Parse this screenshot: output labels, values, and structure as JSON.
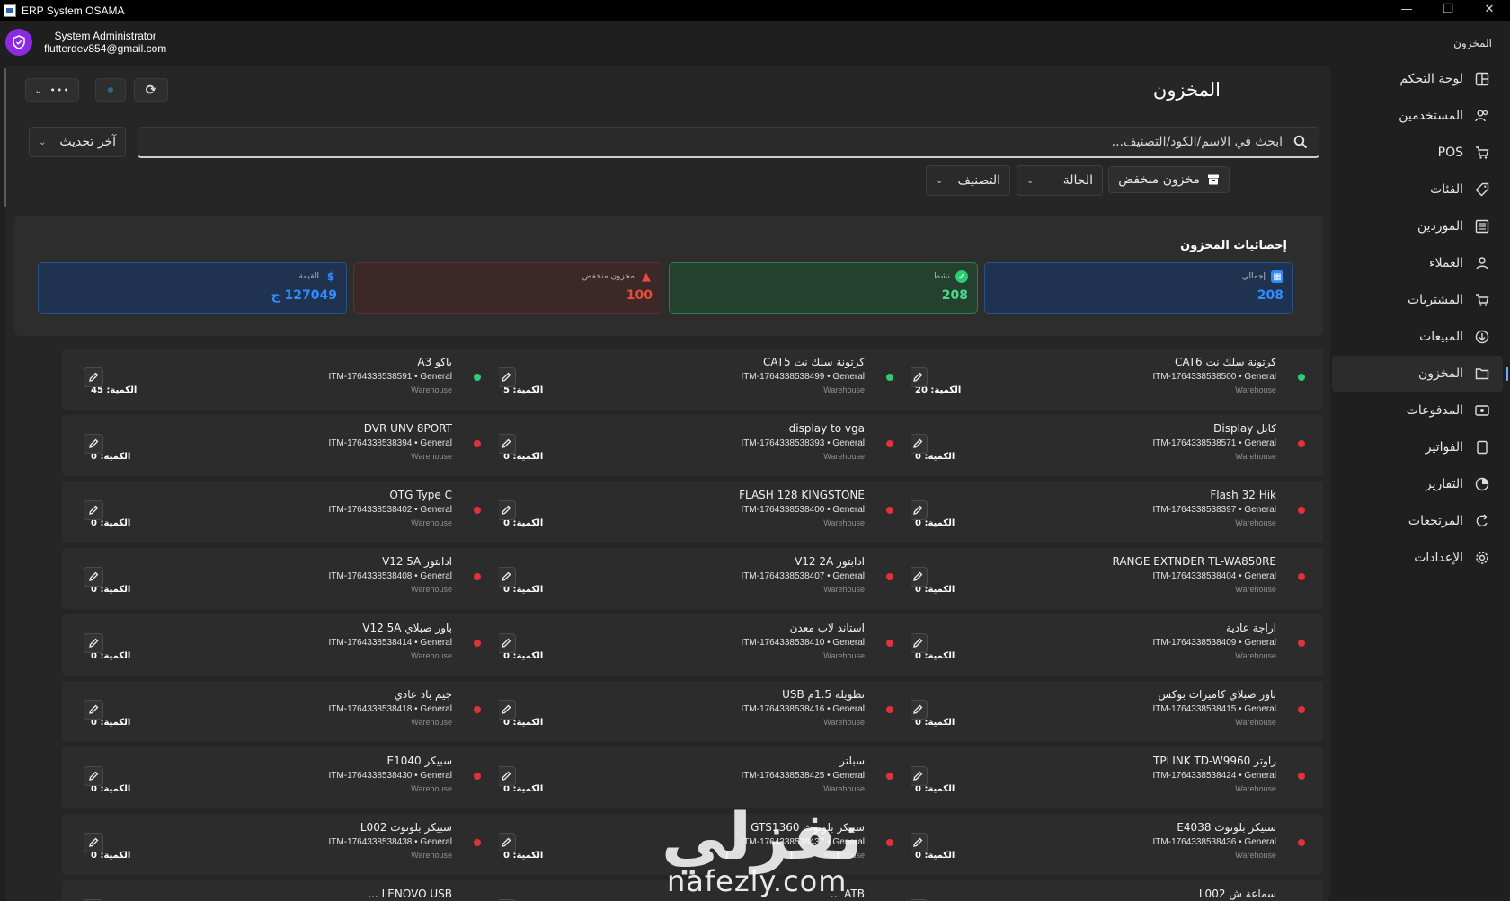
{
  "window": {
    "title": "ERP System OSAMA",
    "min": "—",
    "max": "❐",
    "close": "✕"
  },
  "user": {
    "name": "System Administrator",
    "email": "flutterdev854@gmail.com"
  },
  "breadcrumb": "المخزون",
  "sidebar": {
    "items": [
      {
        "label": "لوحة التحكم",
        "icon": "dashboard-icon"
      },
      {
        "label": "المستخدمين",
        "icon": "users-icon"
      },
      {
        "label": "POS",
        "icon": "cart-icon"
      },
      {
        "label": "الفئات",
        "icon": "tag-icon"
      },
      {
        "label": "الموردين",
        "icon": "suppliers-icon"
      },
      {
        "label": "العملاء",
        "icon": "person-icon"
      },
      {
        "label": "المشتريات",
        "icon": "cart-icon"
      },
      {
        "label": "المبيعات",
        "icon": "sales-icon"
      },
      {
        "label": "المخزون",
        "icon": "folder-icon",
        "active": true
      },
      {
        "label": "المدفوعات",
        "icon": "payments-icon"
      },
      {
        "label": "الفواتير",
        "icon": "invoice-icon"
      },
      {
        "label": "التقارير",
        "icon": "reports-icon"
      },
      {
        "label": "المرتجعات",
        "icon": "returns-icon"
      },
      {
        "label": "الإعدادات",
        "icon": "settings-icon"
      }
    ]
  },
  "page": {
    "title": "المخزون"
  },
  "toolbar": {
    "more": "•••",
    "more_chev": "⌄",
    "refresh": "⟳"
  },
  "search": {
    "placeholder": "ابحث في الاسم/الكود/التصنيف..."
  },
  "sort": {
    "label": "آخر تحديث"
  },
  "filters": {
    "low_stock": "مخزون منخفض",
    "status": "الحالة",
    "category": "التصنيف"
  },
  "stats": {
    "title": "إحصائيات المخزون",
    "total": {
      "label": "إجمالي",
      "value": "208",
      "color": "#2f8cff"
    },
    "active": {
      "label": "نشط",
      "value": "208",
      "color": "#2ecc71"
    },
    "low": {
      "label": "مخزون منخفض",
      "value": "100",
      "color": "#e74c3c"
    },
    "worth": {
      "label": "القيمة",
      "value": "127049 ج",
      "color": "#2f8cff"
    }
  },
  "qty_label": "الكمية:",
  "items": [
    {
      "name": "كرتونة سلك نت CAT6",
      "code": "ITM-1764338538500 • General",
      "wh": "Warehouse",
      "qty": "20",
      "status": "ok"
    },
    {
      "name": "كرتونة سلك نت CAT5",
      "code": "ITM-1764338538499 • General",
      "wh": "Warehouse",
      "qty": "5",
      "status": "ok"
    },
    {
      "name": "باكو A3",
      "code": "ITM-1764338538591 • General",
      "wh": "Warehouse",
      "qty": "45",
      "status": "ok"
    },
    {
      "name": "كابل Display",
      "code": "ITM-1764338538571 • General",
      "wh": "Warehouse",
      "qty": "0",
      "status": "low"
    },
    {
      "name": "display to vga",
      "code": "ITM-1764338538393 • General",
      "wh": "Warehouse",
      "qty": "0",
      "status": "low"
    },
    {
      "name": "DVR UNV 8PORT",
      "code": "ITM-1764338538394 • General",
      "wh": "Warehouse",
      "qty": "0",
      "status": "low"
    },
    {
      "name": "Flash 32 Hik",
      "code": "ITM-1764338538397 • General",
      "wh": "Warehouse",
      "qty": "0",
      "status": "low"
    },
    {
      "name": "FLASH 128 KINGSTONE",
      "code": "ITM-1764338538400 • General",
      "wh": "Warehouse",
      "qty": "0",
      "status": "low"
    },
    {
      "name": "OTG Type C",
      "code": "ITM-1764338538402 • General",
      "wh": "Warehouse",
      "qty": "0",
      "status": "low"
    },
    {
      "name": "RANGE EXTNDER TL-WA850RE",
      "code": "ITM-1764338538404 • General",
      "wh": "Warehouse",
      "qty": "0",
      "status": "low"
    },
    {
      "name": "ادابتور V12 2A",
      "code": "ITM-1764338538407 • General",
      "wh": "Warehouse",
      "qty": "0",
      "status": "low"
    },
    {
      "name": "ادابتور V12 5A",
      "code": "ITM-1764338538408 • General",
      "wh": "Warehouse",
      "qty": "0",
      "status": "low"
    },
    {
      "name": "اراجة عادية",
      "code": "ITM-1764338538409 • General",
      "wh": "Warehouse",
      "qty": "0",
      "status": "low"
    },
    {
      "name": "استاند لاب معدن",
      "code": "ITM-1764338538410 • General",
      "wh": "Warehouse",
      "qty": "0",
      "status": "low"
    },
    {
      "name": "باور صبلاي V12 5A",
      "code": "ITM-1764338538414 • General",
      "wh": "Warehouse",
      "qty": "0",
      "status": "low"
    },
    {
      "name": "باور صبلاي كاميرات بوكس",
      "code": "ITM-1764338538415 • General",
      "wh": "Warehouse",
      "qty": "0",
      "status": "low"
    },
    {
      "name": "تطويلة 1.5م USB",
      "code": "ITM-1764338538416 • General",
      "wh": "Warehouse",
      "qty": "0",
      "status": "low"
    },
    {
      "name": "جيم باد عادي",
      "code": "ITM-1764338538418 • General",
      "wh": "Warehouse",
      "qty": "0",
      "status": "low"
    },
    {
      "name": "راوتر TPLINK TD-W9960",
      "code": "ITM-1764338538424 • General",
      "wh": "Warehouse",
      "qty": "0",
      "status": "low"
    },
    {
      "name": "سبلتر",
      "code": "ITM-1764338538425 • General",
      "wh": "Warehouse",
      "qty": "0",
      "status": "low"
    },
    {
      "name": "سبيكر E1040",
      "code": "ITM-1764338538430 • General",
      "wh": "Warehouse",
      "qty": "0",
      "status": "low"
    },
    {
      "name": "سبيكر بلوتوث E4038",
      "code": "ITM-1764338538436 • General",
      "wh": "Warehouse",
      "qty": "0",
      "status": "low"
    },
    {
      "name": "سبيكر بلوتوث GTS1360",
      "code": "ITM-1764338538437 • General",
      "wh": "Warehouse",
      "qty": "0",
      "status": "low"
    },
    {
      "name": "سبيكر بلوتوث L002",
      "code": "ITM-1764338538438 • General",
      "wh": "Warehouse",
      "qty": "0",
      "status": "low"
    },
    {
      "name": "سماعة ش L002",
      "code": "",
      "wh": "",
      "qty": "",
      "status": "low"
    },
    {
      "name": "ATB ...",
      "code": "",
      "wh": "",
      "qty": "",
      "status": "low"
    },
    {
      "name": "LENOVO USB ...",
      "code": "",
      "wh": "",
      "qty": "",
      "status": "low"
    }
  ],
  "watermark": {
    "arabic": "نفزلي",
    "latin": "nafezly.com"
  }
}
